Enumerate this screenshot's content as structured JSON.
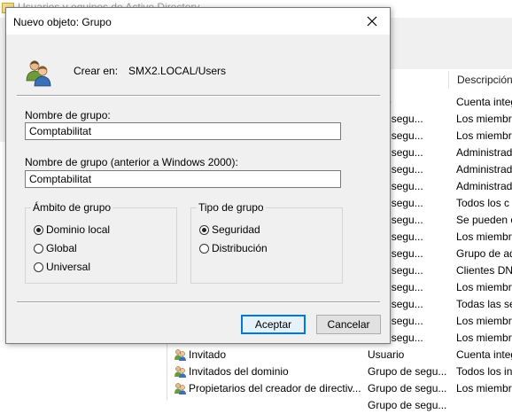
{
  "background_window": {
    "title": "Usuarios y equipos de Active Directory",
    "columns": {
      "type": "",
      "description": "Descripción"
    },
    "rows": [
      {
        "name": "",
        "type": "uario",
        "description": "Cuenta integrada"
      },
      {
        "name": "",
        "type": "o de segu...",
        "description": "Los miembros"
      },
      {
        "name": "",
        "type": "o de segu...",
        "description": "Los miembros"
      },
      {
        "name": "",
        "type": "o de segu...",
        "description": "Administrad"
      },
      {
        "name": "",
        "type": "o de segu...",
        "description": "Administrad"
      },
      {
        "name": "",
        "type": "o de segu...",
        "description": "Administrad"
      },
      {
        "name": "",
        "type": "o de segu...",
        "description": "Todos los c"
      },
      {
        "name": "",
        "type": "o de segu...",
        "description": "Se pueden c"
      },
      {
        "name": "",
        "type": "o de segu...",
        "description": "Los miembros"
      },
      {
        "name": "",
        "type": "o de segu...",
        "description": "Grupo de ad"
      },
      {
        "name": "",
        "type": "o de segu...",
        "description": "Clientes DN"
      },
      {
        "name": "",
        "type": "o de segu...",
        "description": "Los miembros"
      },
      {
        "name": "",
        "type": "o de segu...",
        "description": "Todas las se"
      },
      {
        "name": "",
        "type": "o de segu...",
        "description": "Los miembros"
      },
      {
        "name": "",
        "type": "o de segu...",
        "description": "Los miembros"
      },
      {
        "name": "Invitado",
        "type": "Usuario",
        "description": "Cuenta integ"
      },
      {
        "name": "Invitados del dominio",
        "type": "Grupo de segu...",
        "description": "Todos los inv"
      },
      {
        "name": "Propietarios del creador de directiv...",
        "type": "Grupo de segu...",
        "description": "Los miembros"
      },
      {
        "name": "",
        "type": "Grupo de segu...",
        "description": ""
      }
    ]
  },
  "dialog": {
    "title": "Nuevo objeto: Grupo",
    "create_in_label": "Crear en:",
    "create_in_value": "SMX2.LOCAL/Users",
    "group_name_label": "Nombre de grupo:",
    "group_name_value": "Comptabilitat",
    "group_name_pre2000_label": "Nombre de grupo (anterior a Windows 2000):",
    "group_name_pre2000_value": "Comptabilitat",
    "scope": {
      "title": "Ámbito de grupo",
      "options": [
        "Dominio local",
        "Global",
        "Universal"
      ],
      "selected": "Dominio local"
    },
    "type": {
      "title": "Tipo de grupo",
      "options": [
        "Seguridad",
        "Distribución"
      ],
      "selected": "Seguridad"
    },
    "ok_label": "Aceptar",
    "cancel_label": "Cancelar"
  },
  "colors": {
    "accent": "#0078d7",
    "dialog_bg": "#f0f0f0"
  },
  "icons": [
    "app-icon",
    "close-icon",
    "group-icon",
    "user-icon"
  ]
}
